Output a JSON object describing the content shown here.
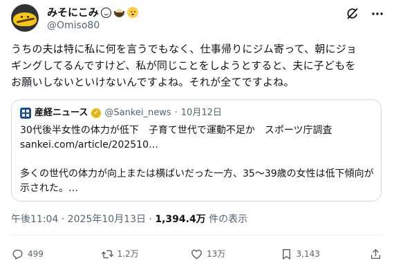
{
  "author": {
    "display_name": "みそにこみ",
    "name_emojis": [
      "smiling-face",
      "bowl",
      "baby-face"
    ],
    "handle": "@Omiso80",
    "avatar": "yellow-bird-avatar"
  },
  "header_icons": [
    "grok-icon",
    "more-icon"
  ],
  "tweet_lines": [
    "うちの夫は特に私に何を言うでもなく、仕事帰りにジム寄って、朝にジョ",
    "ギングしてるんですけど、私が同じことをしようとすると、夫に子どもを",
    "お願いしないといけないんですよね。それが全てですよね。"
  ],
  "quote": {
    "name": "産経ニュース",
    "handle": "@Sankei_news",
    "separator": "·",
    "date": "10月12日",
    "verified_badge_color": "#e2b719",
    "lines": [
      "30代後半女性の体力が低下　子育て世代で運動不足か　スポーツ庁調査",
      "sankei.com/article/202510…"
    ],
    "summary_lines": [
      "多くの世代の体力が向上または横ばいだった一方、35〜39歳の女性は低下傾向が",
      "示された。…"
    ]
  },
  "meta": {
    "time": "午後11:04",
    "separator": "·",
    "date": "2025年10月13日",
    "views_count": "1,394.4万",
    "views_label": "件の表示"
  },
  "actions": {
    "replies": "499",
    "reposts": "1.2万",
    "likes": "13万",
    "bookmarks": "3,143"
  },
  "colors": {
    "text": "#0f1419",
    "secondary": "#536471",
    "border": "#cfd9de"
  }
}
